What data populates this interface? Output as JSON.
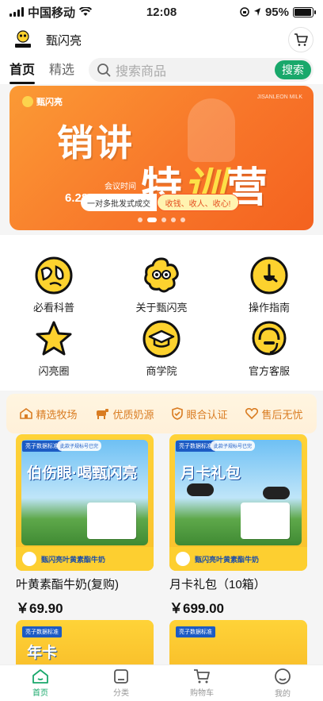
{
  "status_bar": {
    "carrier": "中国移动",
    "time": "12:08",
    "battery_percent_label": "95%",
    "battery_level": 0.95
  },
  "header": {
    "app_title": "甄闪亮",
    "logo_icon": "brand-logo-icon",
    "cart_icon": "cart-icon"
  },
  "tabs": [
    {
      "label": "首页",
      "active": true
    },
    {
      "label": "精选",
      "active": false
    }
  ],
  "search": {
    "placeholder": "搜索商品",
    "button_label": "搜索"
  },
  "banner": {
    "brand": "甄闪亮",
    "english_tag": "JISANLEON MILK",
    "title_line1": "销讲",
    "title_line2_plain": "特",
    "title_line2_accent": "训",
    "title_line2_end": "营",
    "date_label": "会议时间",
    "date_range": "6.28-6.29",
    "cta_left": "一对多批发式成交",
    "cta_right": "收钱、收人、收心!",
    "page_count": 5,
    "active_page": 1
  },
  "grid": [
    {
      "label": "必看科普",
      "icon": "globe-icon"
    },
    {
      "label": "关于甄闪亮",
      "icon": "mascot-icon"
    },
    {
      "label": "操作指南",
      "icon": "compass-icon"
    },
    {
      "label": "闪亮圈",
      "icon": "star-icon"
    },
    {
      "label": "商学院",
      "icon": "graduation-cap-icon"
    },
    {
      "label": "官方客服",
      "icon": "headset-icon"
    }
  ],
  "features": [
    {
      "label": "精选牧场",
      "icon": "farm-icon"
    },
    {
      "label": "优质奶源",
      "icon": "cow-icon"
    },
    {
      "label": "眼合认证",
      "icon": "shield-check-icon"
    },
    {
      "label": "售后无忧",
      "icon": "heart-icon"
    }
  ],
  "products": [
    {
      "name": "叶黄素酯牛奶(复购)",
      "price": "￥69.90",
      "tag": "亮子数据标准",
      "tag2": "此款子规标号已完",
      "headline": "伯伤眼·喝甄闪亮",
      "strip_text": "甄闪亮叶黄素酯牛奶"
    },
    {
      "name": "月卡礼包（10箱）",
      "price": "￥699.00",
      "tag": "亮子数据标准",
      "tag2": "此款子规标号已完",
      "headline": "月卡礼包",
      "strip_text": "甄闪亮叶黄素酯牛奶"
    }
  ],
  "partial_products": [
    {
      "tag": "亮子数据标准",
      "headline": "年卡"
    },
    {
      "tag": "亮子数据标准",
      "headline": ""
    }
  ],
  "bottom_nav": [
    {
      "label": "首页",
      "icon": "home-icon",
      "active": true
    },
    {
      "label": "分类",
      "icon": "category-icon",
      "active": false
    },
    {
      "label": "购物车",
      "icon": "cart-icon",
      "active": false
    },
    {
      "label": "我的",
      "icon": "profile-icon",
      "active": false
    }
  ],
  "colors": {
    "accent_green": "#19a86b",
    "banner_orange": "#f8772a",
    "feature_orange": "#d97c22",
    "icon_yellow": "#fdd22e"
  }
}
